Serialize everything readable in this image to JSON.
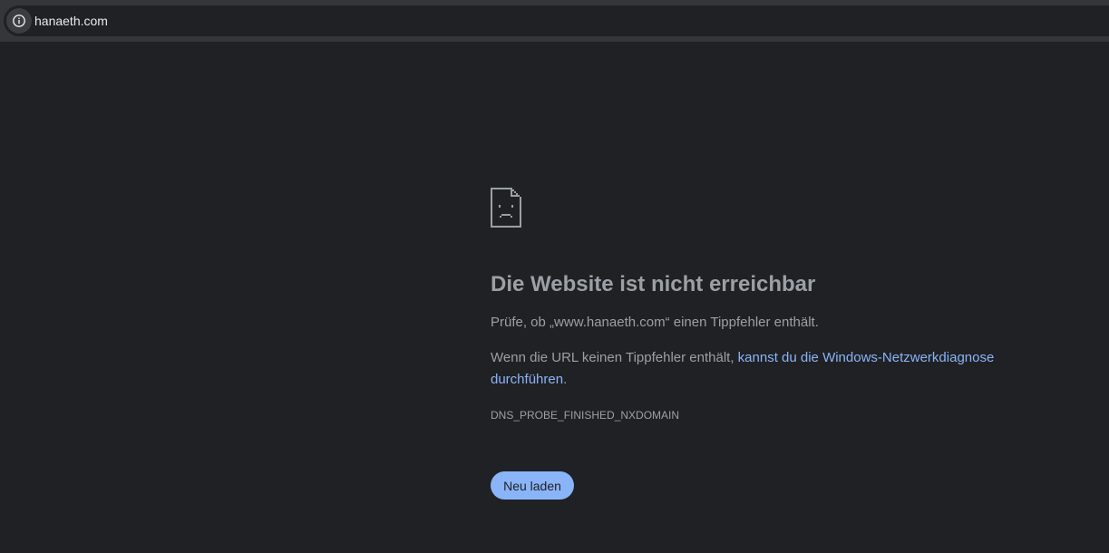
{
  "address_bar": {
    "url": "hanaeth.com",
    "icon": "info-icon"
  },
  "error": {
    "icon": "sad-document-icon",
    "title": "Die Website ist nicht erreichbar",
    "check_text": "Prüfe, ob „www.hanaeth.com“ einen Tippfehler enthält.",
    "diag_prefix": "Wenn die URL keinen Tippfehler enthält, ",
    "diag_link": "kannst du die Windows-Netzwerkdiagnose durchführen",
    "diag_suffix": ".",
    "code": "DNS_PROBE_FINISHED_NXDOMAIN",
    "reload_label": "Neu laden"
  },
  "colors": {
    "background": "#202124",
    "text": "#9aa0a6",
    "link": "#8ab4f8",
    "button": "#8ab4f8"
  }
}
